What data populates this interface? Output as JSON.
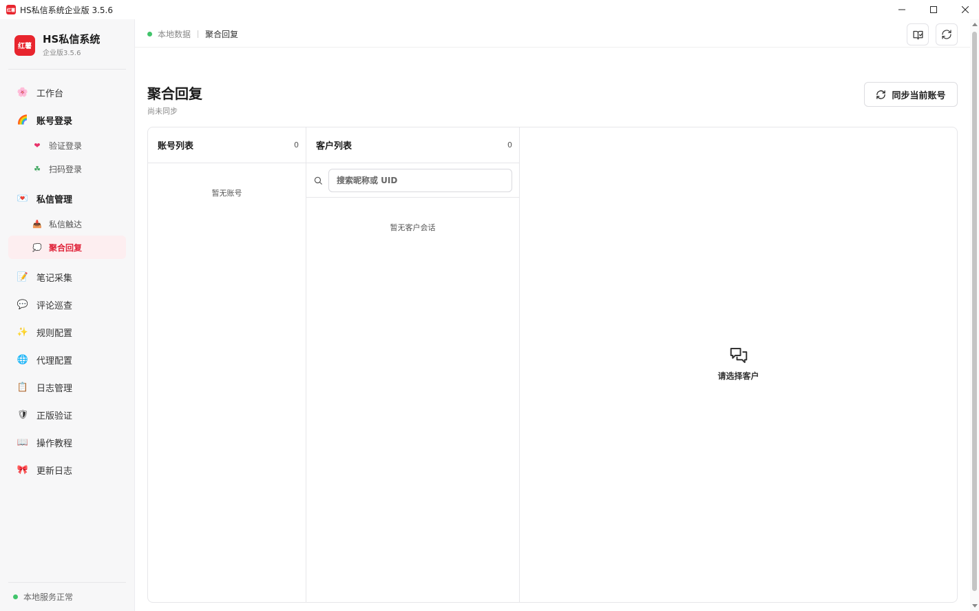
{
  "window": {
    "title": "HS私信系统企业版 3.5.6",
    "logo_text": "红薯"
  },
  "brand": {
    "logo_text": "红薯",
    "name": "HS私信系统",
    "version": "企业版3.5.6"
  },
  "sidebar": {
    "items": [
      {
        "label": "工作台",
        "icon": "flower-icon"
      },
      {
        "label": "账号登录",
        "icon": "rainbow-icon"
      },
      {
        "label": "验证登录",
        "icon": "heart-icon"
      },
      {
        "label": "扫码登录",
        "icon": "clover-icon"
      },
      {
        "label": "私信管理",
        "icon": "love-letter-icon"
      },
      {
        "label": "私信触达",
        "icon": "inbox-tray-icon"
      },
      {
        "label": "聚合回复",
        "icon": "speech-balloon-icon"
      },
      {
        "label": "笔记采集",
        "icon": "memo-icon"
      },
      {
        "label": "评论巡查",
        "icon": "comment-icon"
      },
      {
        "label": "规则配置",
        "icon": "sparkles-icon"
      },
      {
        "label": "代理配置",
        "icon": "globe-icon"
      },
      {
        "label": "日志管理",
        "icon": "clipboard-icon"
      },
      {
        "label": "正版验证",
        "icon": "shield-icon"
      },
      {
        "label": "操作教程",
        "icon": "open-book-icon"
      },
      {
        "label": "更新日志",
        "icon": "ribbon-icon"
      }
    ],
    "active": "聚合回复",
    "service_status": "本地服务正常"
  },
  "topbar": {
    "breadcrumb_local": "本地数据",
    "breadcrumb_current": "聚合回复"
  },
  "page": {
    "title": "聚合回复",
    "subtitle": "尚未同步",
    "sync_button": "同步当前账号"
  },
  "accounts": {
    "header": "账号列表",
    "count": "0",
    "empty": "暂无账号"
  },
  "customers": {
    "header": "客户列表",
    "count": "0",
    "search_placeholder": "搜索昵称或 UID",
    "empty": "暂无客户会话"
  },
  "chat": {
    "empty": "请选择客户"
  },
  "colors": {
    "accent": "#e8252e",
    "active_bg": "#fdeef0",
    "active_text": "#e0243a",
    "status_green": "#41c46b"
  }
}
